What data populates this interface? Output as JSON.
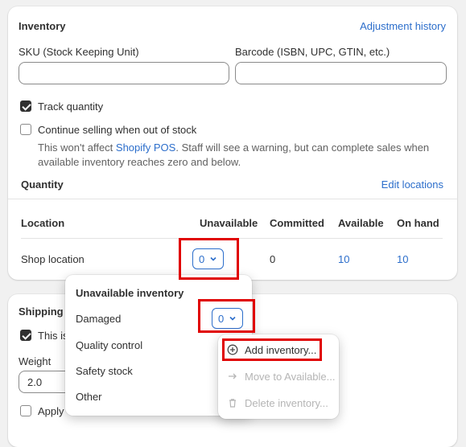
{
  "inventory": {
    "title": "Inventory",
    "adjustment_history": "Adjustment history",
    "sku_label": "SKU (Stock Keeping Unit)",
    "sku_value": "",
    "barcode_label": "Barcode (ISBN, UPC, GTIN, etc.)",
    "barcode_value": "",
    "track_quantity": {
      "label": "Track quantity",
      "checked": true
    },
    "continue_selling": {
      "label": "Continue selling when out of stock",
      "checked": false,
      "help_before": "This won't affect ",
      "help_link": "Shopify POS",
      "help_after": ". Staff will see a warning, but can complete sales when",
      "help_line2": "available inventory reaches zero and below."
    },
    "quantity_title": "Quantity",
    "edit_locations": "Edit locations",
    "table": {
      "columns": [
        "Location",
        "Unavailable",
        "Committed",
        "Available",
        "On hand"
      ],
      "rows": [
        {
          "location": "Shop location",
          "unavailable": "0",
          "committed": "0",
          "available": "10",
          "on_hand": "10"
        }
      ]
    }
  },
  "shipping": {
    "title": "Shipping",
    "physical_label_partial": "This is",
    "weight_label": "Weight",
    "weight_value": "2.0",
    "apply_partial": "Apply"
  },
  "unavailable_popover": {
    "title": "Unavailable inventory",
    "items": [
      {
        "label": "Damaged",
        "value": "0"
      },
      {
        "label": "Quality control"
      },
      {
        "label": "Safety stock"
      },
      {
        "label": "Other"
      }
    ]
  },
  "action_menu": {
    "items": [
      {
        "label": "Add inventory...",
        "icon": "plus-circle-icon",
        "enabled": true
      },
      {
        "label": "Move to Available...",
        "icon": "arrow-right-icon",
        "enabled": false
      },
      {
        "label": "Delete inventory...",
        "icon": "trash-icon",
        "enabled": false
      }
    ]
  },
  "colors": {
    "link": "#2c6ecb",
    "highlight": "#e00000",
    "text": "#303030"
  }
}
